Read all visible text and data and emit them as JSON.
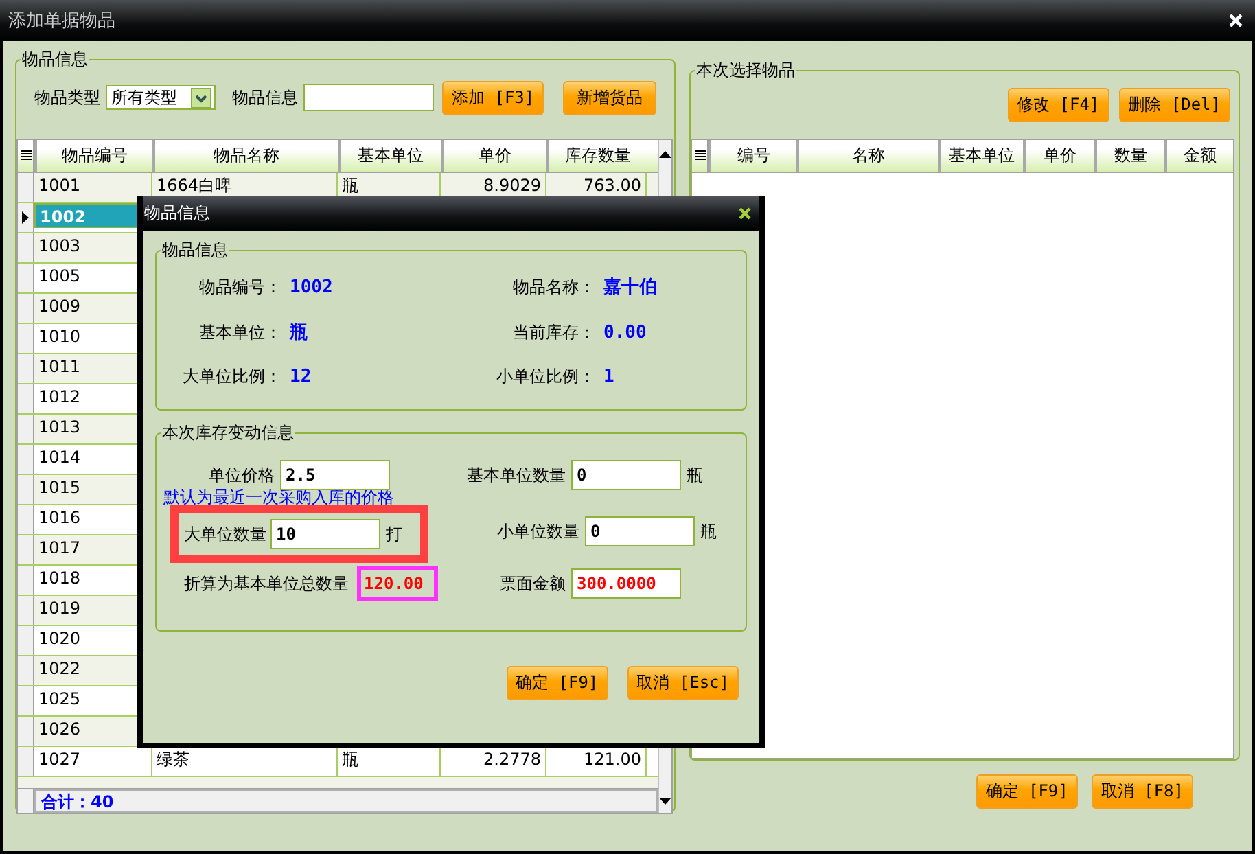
{
  "window": {
    "title": "添加单据物品"
  },
  "item_panel": {
    "title": "物品信息",
    "type_label": "物品类型",
    "type_value": "所有类型",
    "info_label": "物品信息",
    "buttons": [
      "添加 [F3]",
      "新增货品"
    ],
    "columns": [
      "物品编号",
      "物品名称",
      "基本单位",
      "单价",
      "库存数量"
    ],
    "rows": [
      {
        "cells": [
          "1001",
          "1664白啤",
          "瓶",
          "8.9029",
          "763.00"
        ],
        "selected": false
      },
      {
        "cells": [
          "1002"
        ],
        "selected": true
      },
      {
        "cells": [
          "1003"
        ],
        "selected": false
      },
      {
        "cells": [
          "1005"
        ],
        "selected": false
      },
      {
        "cells": [
          "1009"
        ],
        "selected": false
      },
      {
        "cells": [
          "1010"
        ],
        "selected": false
      },
      {
        "cells": [
          "1011"
        ],
        "selected": false
      },
      {
        "cells": [
          "1012"
        ],
        "selected": false
      },
      {
        "cells": [
          "1013"
        ],
        "selected": false
      },
      {
        "cells": [
          "1014"
        ],
        "selected": false
      },
      {
        "cells": [
          "1015"
        ],
        "selected": false
      },
      {
        "cells": [
          "1016"
        ],
        "selected": false
      },
      {
        "cells": [
          "1017"
        ],
        "selected": false
      },
      {
        "cells": [
          "1018"
        ],
        "selected": false
      },
      {
        "cells": [
          "1019"
        ],
        "selected": false
      },
      {
        "cells": [
          "1020"
        ],
        "selected": false
      },
      {
        "cells": [
          "1022"
        ],
        "selected": false
      },
      {
        "cells": [
          "1025"
        ],
        "selected": false
      },
      {
        "cells": [
          "1026"
        ],
        "selected": false
      },
      {
        "cells": [
          "1027",
          "绿茶",
          "瓶",
          "2.2778",
          "121.00"
        ],
        "selected": false
      }
    ],
    "total": "合计：40"
  },
  "selected_panel": {
    "title": "本次选择物品",
    "buttons": [
      "修改 [F4]",
      "删除 [Del]"
    ],
    "columns": [
      "编号",
      "名称",
      "基本单位",
      "单价",
      "数量",
      "金额"
    ]
  },
  "buttons": [
    "确定 [F9]",
    "取消 [F8]"
  ],
  "dialog": {
    "title": "物品信息",
    "info_group": {
      "title": "物品信息",
      "fields": [
        {
          "label": "物品编号：",
          "value": "1002"
        },
        {
          "label": "物品名称：",
          "value": "嘉十伯"
        },
        {
          "label": "基本单位：",
          "value": "瓶"
        },
        {
          "label": "当前库存：",
          "value": "0.00"
        },
        {
          "label": "大单位比例：",
          "value": "12"
        },
        {
          "label": "小单位比例：",
          "value": "1"
        }
      ]
    },
    "change_group": {
      "title": "本次库存变动信息",
      "rows": [
        {
          "kind": "fields",
          "fields": [
            {
              "kind": "input",
              "label": "单位价格",
              "value": "2.5"
            },
            {
              "kind": "input",
              "label": "基本单位数量",
              "value": "0",
              "unit": "瓶"
            }
          ]
        },
        {
          "kind": "hint",
          "text": "默认为最近一次采购入库的价格"
        },
        {
          "kind": "fields",
          "fields": [
            {
              "kind": "input",
              "label": "大单位数量",
              "value": "10",
              "unit": "打",
              "color": "#ff4040"
            },
            {
              "kind": "input",
              "label": "小单位数量",
              "value": "0",
              "unit": "瓶"
            }
          ]
        },
        {
          "kind": "fields",
          "fields": [
            {
              "kind": "readout",
              "label": "折算为基本单位总数量",
              "value": "120.00",
              "emphasis": true,
              "color": "#ff33ff"
            },
            {
              "kind": "input",
              "label": "票面金额",
              "value": "300.0000",
              "emphasis": true
            }
          ]
        }
      ]
    },
    "buttons": [
      "确定 [F9]",
      "取消 [Esc]"
    ]
  }
}
